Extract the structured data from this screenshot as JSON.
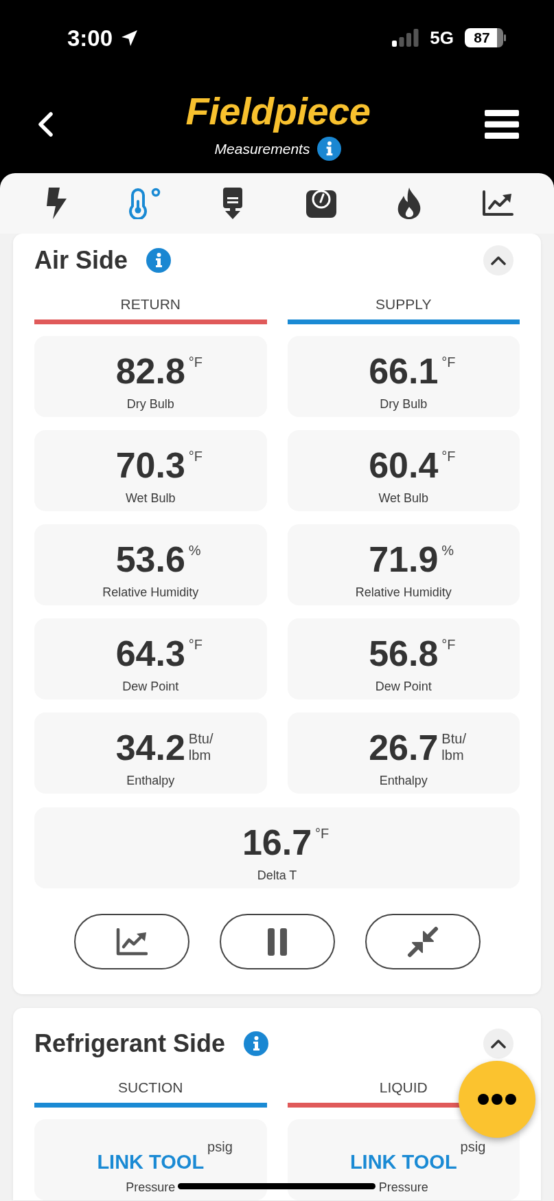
{
  "status_bar": {
    "time": "3:00",
    "network": "5G",
    "battery": "87"
  },
  "header": {
    "logo": "Fieldpiece",
    "subtitle": "Measurements"
  },
  "tabs": [
    {
      "kind": "bolt",
      "selected": false
    },
    {
      "kind": "thermometer",
      "selected": true
    },
    {
      "kind": "probe",
      "selected": false
    },
    {
      "kind": "scale",
      "selected": false
    },
    {
      "kind": "flame",
      "selected": false
    },
    {
      "kind": "chart",
      "selected": false
    }
  ],
  "sections": [
    {
      "title": "Air Side",
      "expanded": true,
      "columns": [
        {
          "label": "RETURN",
          "color": "#e05a5a",
          "tiles": [
            {
              "kind": "reading",
              "value": "82.8",
              "unit": "°F",
              "label": "Dry Bulb"
            },
            {
              "kind": "reading",
              "value": "70.3",
              "unit": "°F",
              "label": "Wet Bulb"
            },
            {
              "kind": "reading",
              "value": "53.6",
              "unit": "%",
              "label": "Relative Humidity"
            },
            {
              "kind": "reading",
              "value": "64.3",
              "unit": "°F",
              "label": "Dew Point"
            },
            {
              "kind": "reading",
              "value": "34.2",
              "unit": "Btu/ lbm",
              "label": "Enthalpy"
            }
          ]
        },
        {
          "label": "SUPPLY",
          "color": "#1a8ad4",
          "tiles": [
            {
              "kind": "reading",
              "value": "66.1",
              "unit": "°F",
              "label": "Dry Bulb"
            },
            {
              "kind": "reading",
              "value": "60.4",
              "unit": "°F",
              "label": "Wet Bulb"
            },
            {
              "kind": "reading",
              "value": "71.9",
              "unit": "%",
              "label": "Relative Humidity"
            },
            {
              "kind": "reading",
              "value": "56.8",
              "unit": "°F",
              "label": "Dew Point"
            },
            {
              "kind": "reading",
              "value": "26.7",
              "unit": "Btu/ lbm",
              "label": "Enthalpy"
            }
          ]
        }
      ],
      "summary": {
        "kind": "reading",
        "value": "16.7",
        "unit": "°F",
        "label": "Delta T"
      },
      "actions": [
        {
          "kind": "chart"
        },
        {
          "kind": "pause"
        },
        {
          "kind": "shrink"
        }
      ]
    },
    {
      "title": "Refrigerant Side",
      "expanded": true,
      "columns": [
        {
          "label": "SUCTION",
          "color": "#1a8ad4",
          "tiles": [
            {
              "kind": "link",
              "value": "LINK TOOL",
              "unit": "psig",
              "label": "Pressure"
            }
          ]
        },
        {
          "label": "LIQUID",
          "color": "#e05a5a",
          "tiles": [
            {
              "kind": "link",
              "value": "LINK TOOL",
              "unit": "psig",
              "label": "Pressure"
            }
          ]
        }
      ]
    }
  ]
}
